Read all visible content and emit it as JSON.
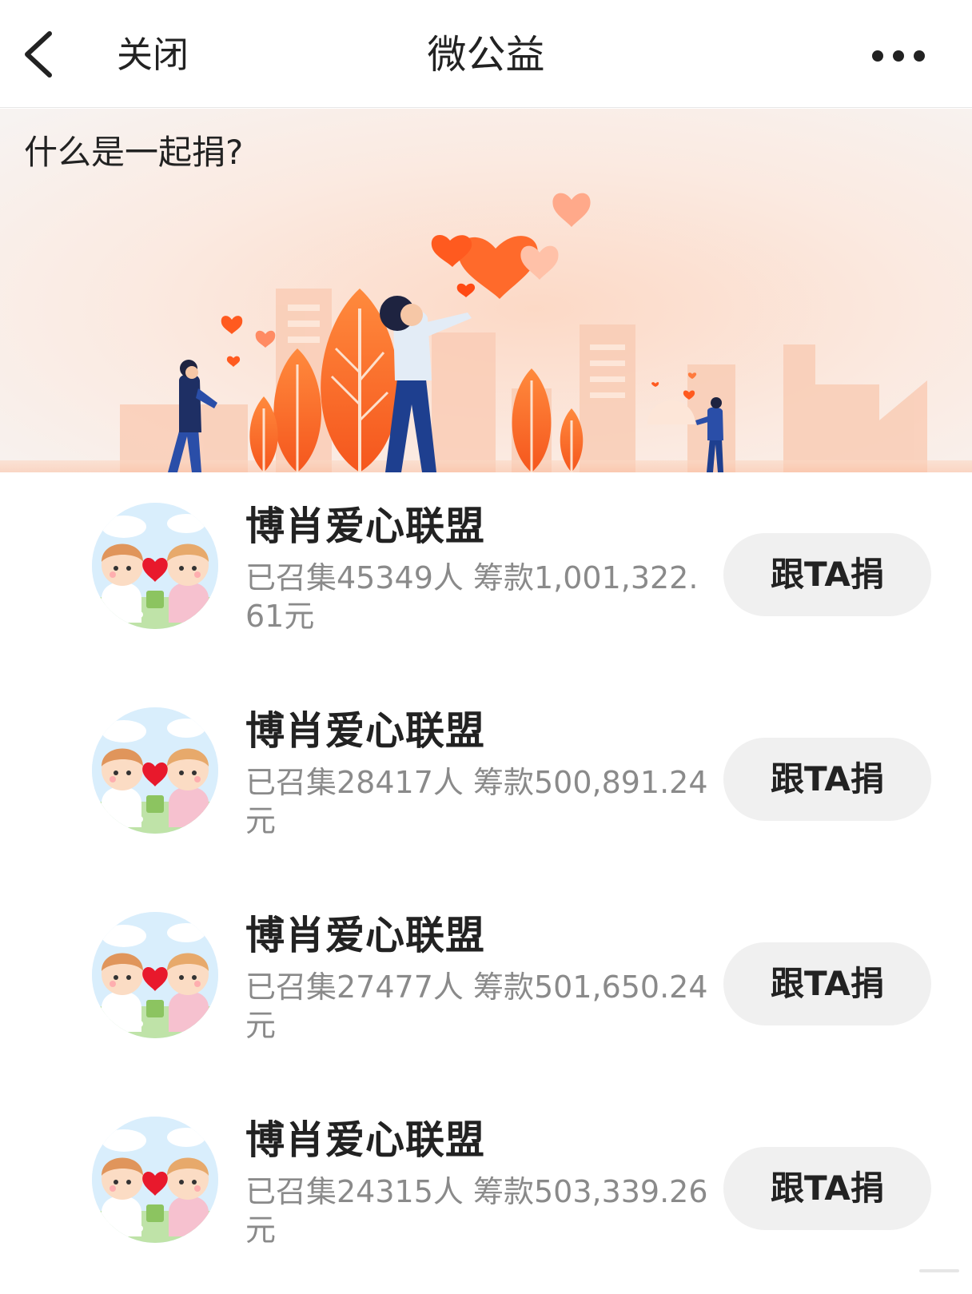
{
  "nav": {
    "back_icon": "chevron-left-icon",
    "close_label": "关闭",
    "title": "微公益",
    "more_icon": "more-dots-icon"
  },
  "banner": {
    "title": "什么是一起捐?",
    "colors": {
      "accent": "#ff7a2e",
      "bg": "#fbe3d6"
    }
  },
  "groups": [
    {
      "name": "博肖爱心联盟",
      "stats": "已召集45349人 筹款1,001,322.61元",
      "button": "跟TA捐"
    },
    {
      "name": "博肖爱心联盟",
      "stats": "已召集28417人 筹款500,891.24元",
      "button": "跟TA捐"
    },
    {
      "name": "博肖爱心联盟",
      "stats": "已召集27477人 筹款501,650.24元",
      "button": "跟TA捐"
    },
    {
      "name": "博肖爱心联盟",
      "stats": "已召集24315人 筹款503,339.26元",
      "button": "跟TA捐"
    }
  ]
}
